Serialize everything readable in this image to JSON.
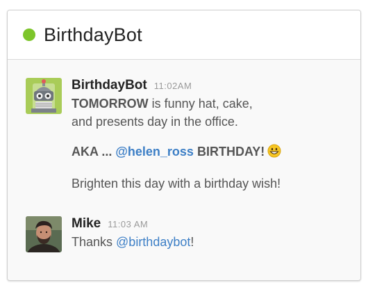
{
  "channel": {
    "title": "BirthdayBot",
    "status_color": "#7dc52b"
  },
  "messages": [
    {
      "sender": "BirthdayBot",
      "time": "11:02AM",
      "avatar_icon": "robot-icon",
      "line1_bold": "TOMORROW",
      "line1_rest": " is funny hat, cake,",
      "line2": "and presents day in the office.",
      "aka_prefix": "AKA ... ",
      "aka_mention": "@helen_ross",
      "aka_suffix": " BIRTHDAY!",
      "aka_emoji": "grinning-face-icon",
      "line4": "Brighten this day with a birthday wish!"
    },
    {
      "sender": "Mike",
      "time": "11:03 AM",
      "avatar_icon": "user-photo-avatar",
      "text_prefix": "Thanks ",
      "text_mention": "@birthdaybot",
      "text_suffix": "!"
    }
  ],
  "colors": {
    "mention": "#3d7fc6",
    "text": "#555555",
    "sender": "#222222",
    "timestamp": "#9a9a9a"
  }
}
